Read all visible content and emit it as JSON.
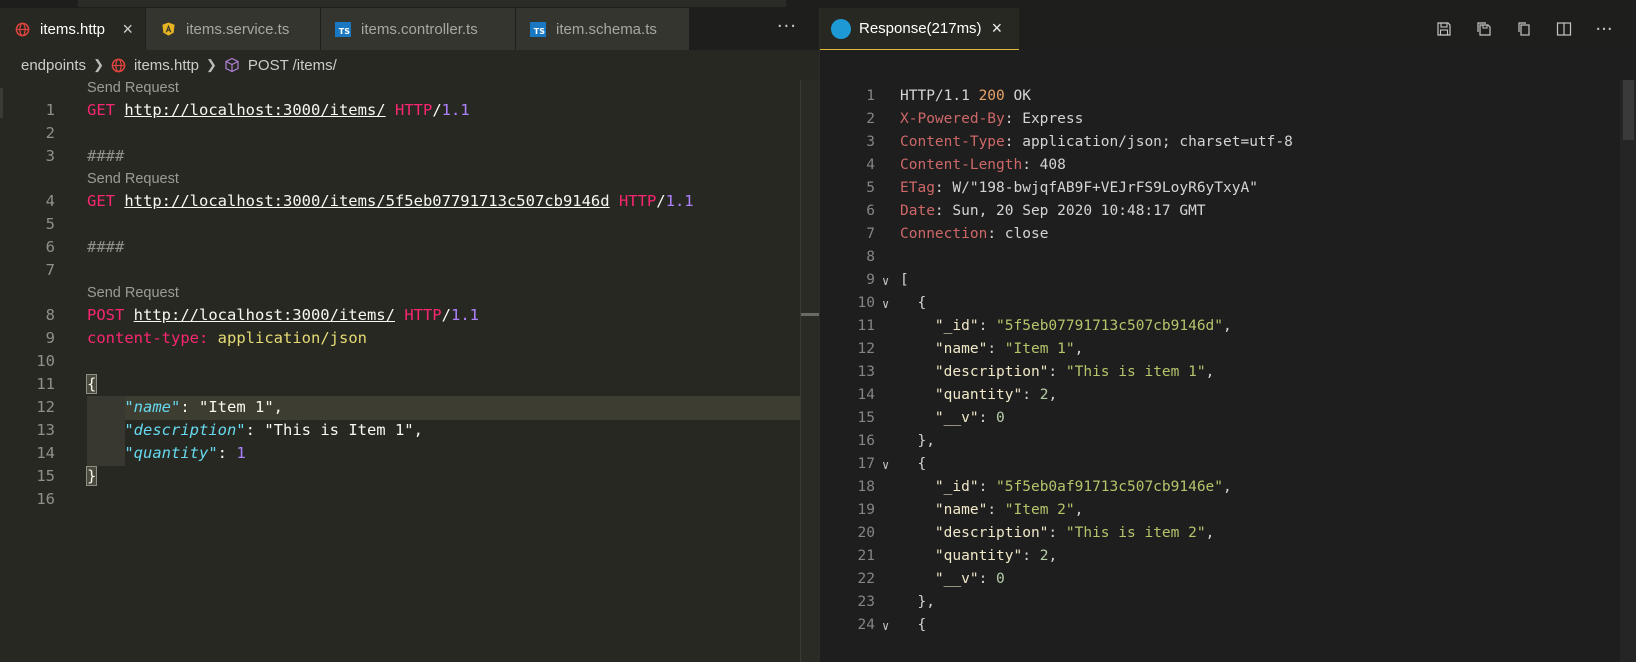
{
  "left": {
    "tabs": [
      {
        "label": "items.http",
        "icon": "globe-icon",
        "active": true
      },
      {
        "label": "items.service.ts",
        "icon": "angular-icon",
        "active": false
      },
      {
        "label": "items.controller.ts",
        "icon": "typescript-icon",
        "active": false
      },
      {
        "label": "item.schema.ts",
        "icon": "typescript-icon",
        "active": false
      }
    ],
    "more_label": "···",
    "close_label": "×",
    "breadcrumb": {
      "folder": "endpoints",
      "file": "items.http",
      "symbol": "POST /items/"
    },
    "lens": "Send Request",
    "lines": {
      "l1": {
        "method": "GET",
        "url": "http://localhost:3000/items/",
        "proto": "HTTP",
        "slash": "/",
        "version": "1.1"
      },
      "l3": "####",
      "l4": {
        "method": "GET",
        "url": "http://localhost:3000/items/5f5eb07791713c507cb9146d",
        "proto": "HTTP",
        "slash": "/",
        "version": "1.1"
      },
      "l6": "####",
      "l8": {
        "method": "POST",
        "url": "http://localhost:3000/items/",
        "proto": "HTTP",
        "slash": "/",
        "version": "1.1"
      },
      "l9": {
        "key": "content-type:",
        "value": "application/json"
      },
      "l11": "{",
      "l12": {
        "key": "\"name\"",
        "colon": ": ",
        "value": "\"Item 1\"",
        "comma": ","
      },
      "l13": {
        "key": "\"description\"",
        "colon": ": ",
        "value": "\"This is Item 1\"",
        "comma": ","
      },
      "l14": {
        "key": "\"quantity\"",
        "colon": ": ",
        "value": "1"
      },
      "l15": "}"
    }
  },
  "right": {
    "tab": {
      "label": "Response(217ms)",
      "close_label": "×"
    },
    "lines": {
      "r1": {
        "proto": "HTTP/1.1 ",
        "status": "200",
        "text": " OK"
      },
      "r2": {
        "key": "X-Powered-By",
        "value": ": Express"
      },
      "r3": {
        "key": "Content-Type",
        "value": ": application/json; charset=utf-8"
      },
      "r4": {
        "key": "Content-Length",
        "value": ": 408"
      },
      "r5": {
        "key": "ETag",
        "value": ": W/\"198-bwjqfAB9F+VEJrFS9LoyR6yTxyA\""
      },
      "r6": {
        "key": "Date",
        "value": ": Sun, 20 Sep 2020 10:48:17 GMT"
      },
      "r7": {
        "key": "Connection",
        "value": ": close"
      },
      "r9": "[",
      "r10": "  {",
      "r11": {
        "key": "\"_id\"",
        "value": "\"5f5eb07791713c507cb9146d\""
      },
      "r12": {
        "key": "\"name\"",
        "value": "\"Item 1\""
      },
      "r13": {
        "key": "\"description\"",
        "value": "\"This is item 1\""
      },
      "r14": {
        "key": "\"quantity\"",
        "value": "2"
      },
      "r15": {
        "key": "\"__v\"",
        "value": "0"
      },
      "r16": "  },",
      "r17": "  {",
      "r18": {
        "key": "\"_id\"",
        "value": "\"5f5eb0af91713c507cb9146e\""
      },
      "r19": {
        "key": "\"name\"",
        "value": "\"Item 2\""
      },
      "r20": {
        "key": "\"description\"",
        "value": "\"This is item 2\""
      },
      "r21": {
        "key": "\"quantity\"",
        "value": "2"
      },
      "r22": {
        "key": "\"__v\"",
        "value": "0"
      },
      "r23": "  },",
      "r24": "  {"
    }
  },
  "colors": {
    "keyword": "#f92672",
    "string": "#e6db74",
    "number": "#ae81ff",
    "json_key": "#66d9ef",
    "header_key": "#ce6868"
  }
}
